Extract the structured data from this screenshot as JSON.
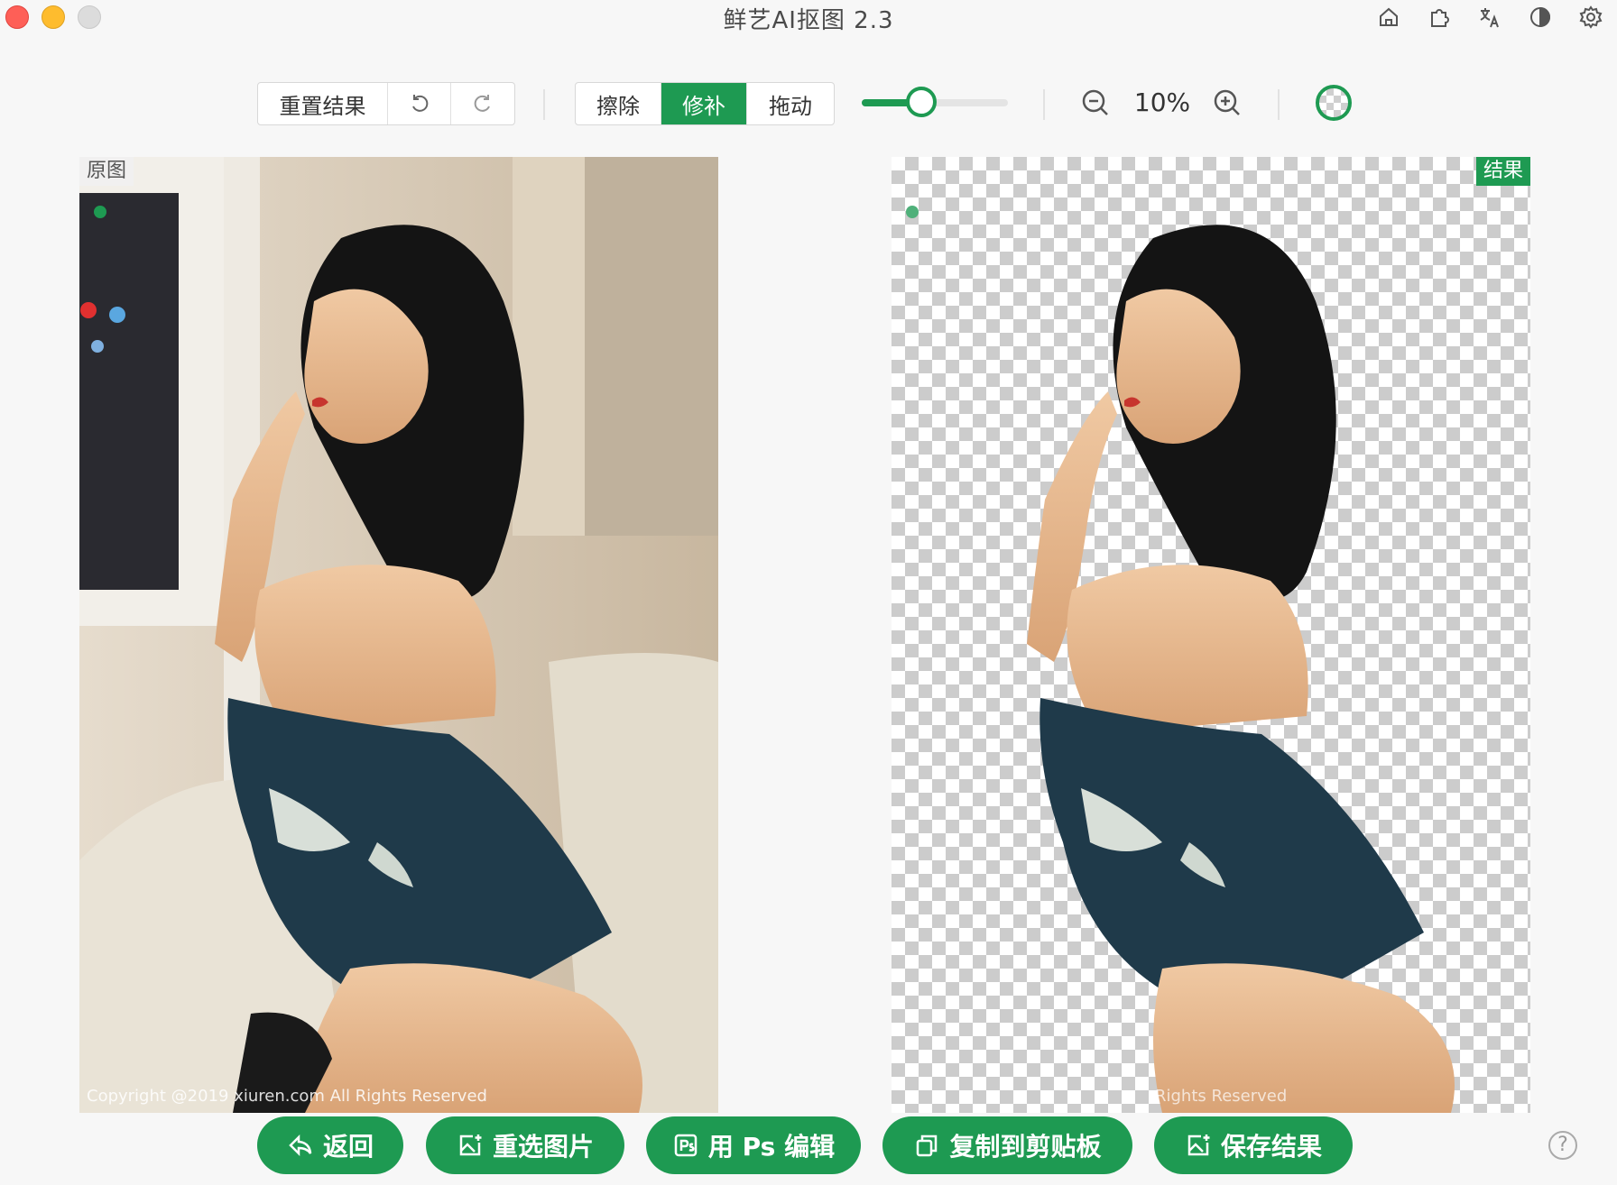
{
  "window": {
    "title": "鲜艺AI抠图 2.3",
    "icons": [
      "home-icon",
      "plugin-icon",
      "translate-icon",
      "contrast-icon",
      "settings-icon"
    ]
  },
  "toolbar": {
    "reset_label": "重置结果",
    "modes": [
      {
        "label": "擦除",
        "active": false
      },
      {
        "label": "修补",
        "active": true
      },
      {
        "label": "拖动",
        "active": false
      }
    ],
    "brush_size_fraction": 0.41,
    "zoom_label": "10%"
  },
  "panels": {
    "original_tag": "原图",
    "result_tag": "结果",
    "original_copyright": "Copyright @2019  xiuren.com  All Rights Reserved",
    "result_copyright": "Rights Reserved"
  },
  "actions": {
    "back": "返回",
    "reselect": "重选图片",
    "ps_edit": "用 Ps 编辑",
    "copy": "复制到剪贴板",
    "save": "保存结果"
  },
  "help_label": "?",
  "colors": {
    "accent": "#1e9a52"
  }
}
